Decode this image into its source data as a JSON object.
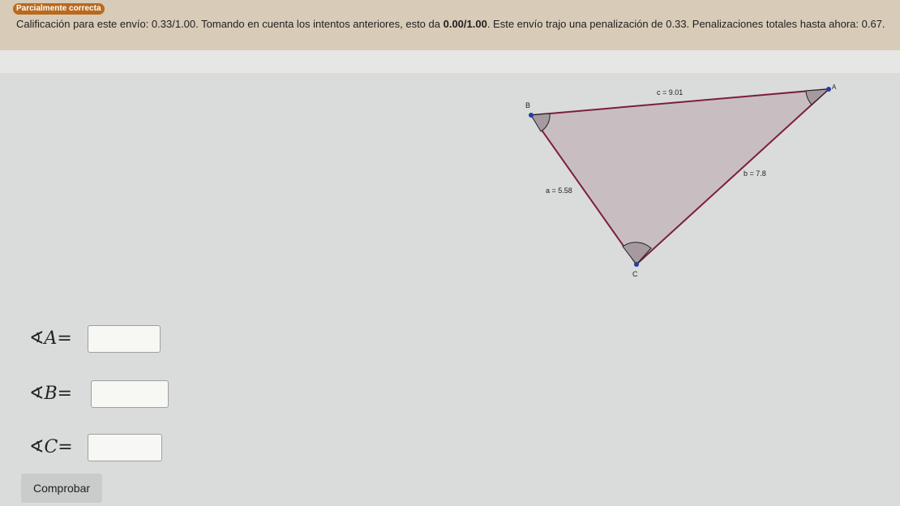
{
  "feedback": {
    "badge": "Parcialmente correcta",
    "text_pre": "Calificación para este envío: 0.33/1.00. Tomando en cuenta los intentos anteriores, esto da ",
    "text_bold": "0.00/1.00",
    "text_post": ". Este envío trajo una penalización de 0.33. Penalizaciones totales hasta ahora: 0.67."
  },
  "figure": {
    "vertex_a": "A",
    "vertex_b": "B",
    "vertex_c": "C",
    "side_a": "a = 5.58",
    "side_b": "b = 7.8",
    "side_c": "c = 9.01",
    "colors": {
      "fill": "#c4b8bd",
      "stroke": "#7d1f3a",
      "vertex": "#1f3f9f"
    }
  },
  "answers": [
    {
      "symbol": "∢",
      "letter": "A",
      "equals": "=",
      "value": ""
    },
    {
      "symbol": "∢",
      "letter": "B",
      "equals": "=",
      "value": ""
    },
    {
      "symbol": "∢",
      "letter": "C",
      "equals": "=",
      "value": ""
    }
  ],
  "check_button": "Comprobar"
}
